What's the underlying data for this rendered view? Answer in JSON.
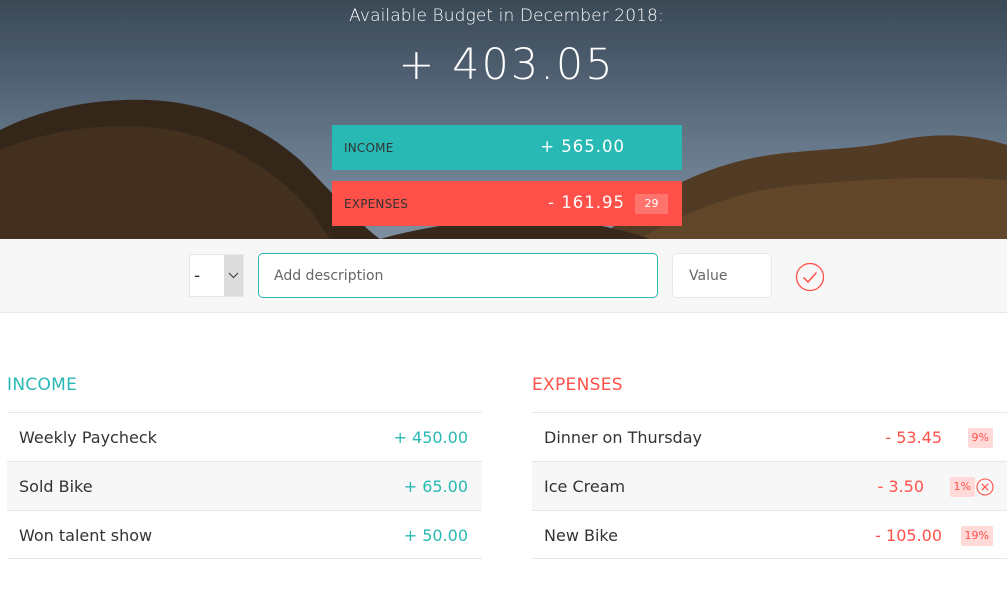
{
  "header": {
    "title": "Available Budget in December 2018:",
    "budget": "+ 403.05",
    "income": {
      "label": "INCOME",
      "value": "+ 565.00"
    },
    "expenses": {
      "label": "EXPENSES",
      "value": "- 161.95",
      "percentage": "29"
    }
  },
  "add_bar": {
    "type_value": "-",
    "description_placeholder": "Add description",
    "value_placeholder": "Value",
    "add_icon": "check-circle-icon"
  },
  "income": {
    "title": "INCOME",
    "items": [
      {
        "description": "Weekly Paycheck",
        "value": "+ 450.00"
      },
      {
        "description": "Sold Bike",
        "value": "+ 65.00"
      },
      {
        "description": "Won talent show",
        "value": "+ 50.00"
      }
    ]
  },
  "expenses": {
    "title": "EXPENSES",
    "items": [
      {
        "description": "Dinner on Thursday",
        "value": "- 53.45",
        "percentage": "9%"
      },
      {
        "description": "Ice Cream",
        "value": "- 3.50",
        "percentage": "1%",
        "delete_icon": "close-circle-icon"
      },
      {
        "description": "New Bike",
        "value": "- 105.00",
        "percentage": "19%"
      }
    ]
  },
  "colors": {
    "income": "#28B9B5",
    "expenses": "#FF5049",
    "percentage_bg": "#FFDAD9"
  }
}
